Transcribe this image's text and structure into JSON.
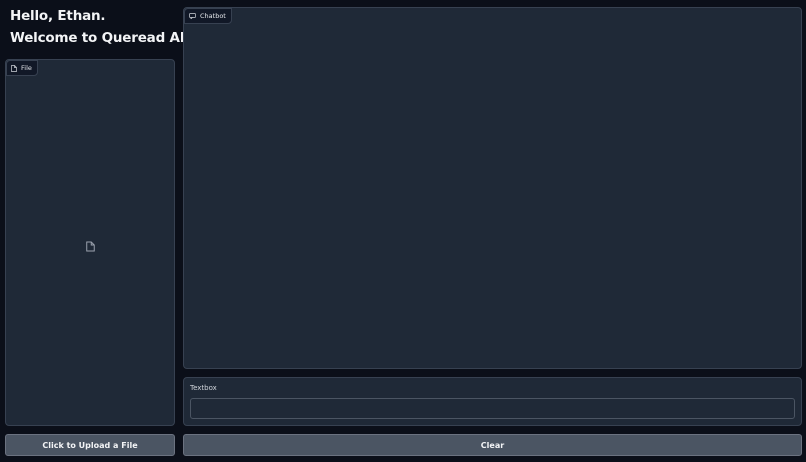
{
  "header": {
    "greeting": "Hello, Ethan.",
    "welcome": "Welcome to Queread AI"
  },
  "file_panel": {
    "label": "File",
    "icon": "file-icon",
    "placeholder_icon": "file-icon"
  },
  "chat_panel": {
    "label": "Chatbot",
    "icon": "chat-icon"
  },
  "textbox": {
    "label": "Textbox",
    "value": "",
    "placeholder": ""
  },
  "buttons": {
    "upload_label": "Click to Upload a File",
    "clear_label": "Clear"
  },
  "colors": {
    "background": "#0b0f19",
    "panel": "#1f2937",
    "border": "#374151",
    "button": "#4b5563"
  }
}
